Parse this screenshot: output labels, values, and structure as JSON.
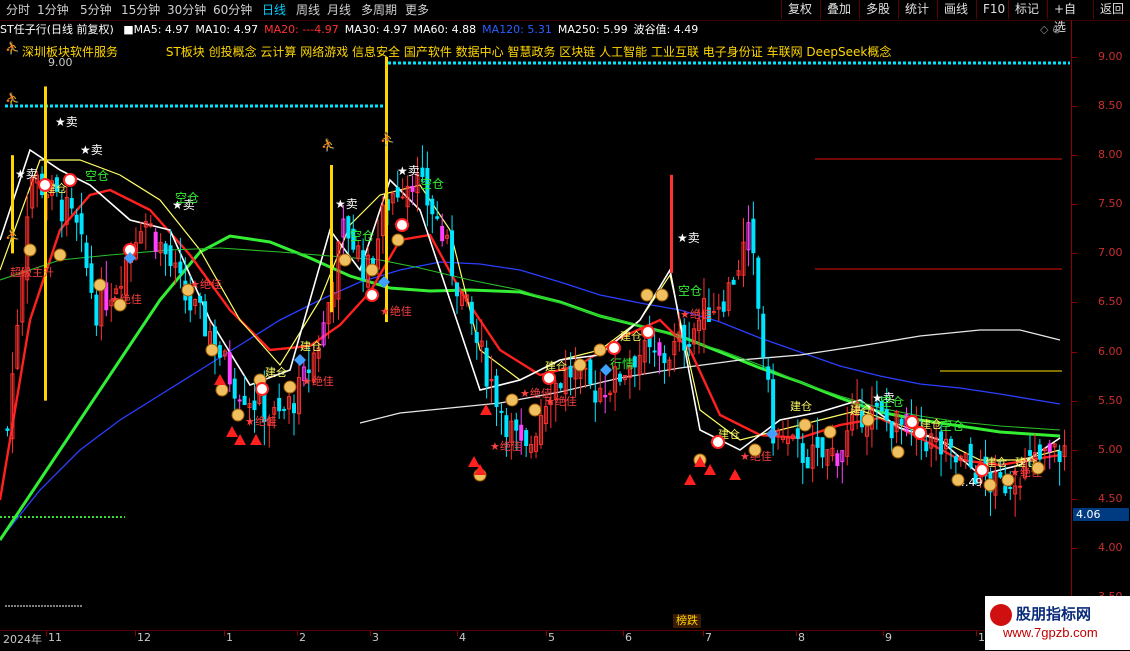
{
  "toolbar": {
    "periods": [
      "分时",
      "1分钟",
      "5分钟",
      "15分钟",
      "30分钟",
      "60分钟",
      "日线",
      "周线",
      "月线",
      "多周期",
      "更多"
    ],
    "active_period": "日线",
    "right_buttons": [
      "复权",
      "叠加",
      "多股",
      "统计",
      "画线",
      "F10",
      "标记",
      "+自选",
      "返回"
    ]
  },
  "header": {
    "title": "ST任子行(日线 前复权)",
    "ma": [
      {
        "label": "MA5: 4.97",
        "color": "#ffffff"
      },
      {
        "label": "MA10: 4.97",
        "color": "#ffffff"
      },
      {
        "label": "MA20: ---4.97",
        "color": "#ff3030"
      },
      {
        "label": "MA30: 4.97",
        "color": "#ffffff"
      },
      {
        "label": "MA60: 4.88",
        "color": "#ffffff"
      },
      {
        "label": "MA120: 5.31",
        "color": "#2a5fff"
      },
      {
        "label": "MA250: 5.99",
        "color": "#ffffff"
      },
      {
        "label": "波谷值: 4.49",
        "color": "#ffffff"
      }
    ],
    "concepts_left": "深圳板块软件服务",
    "concepts_right": "ST板块 创投概念 云计算 网络游戏 信息安全 国产软件 数据中心 智慧政务 区块链 人工智能 工业互联 电子身份证 车联网 DeepSeek概念"
  },
  "yaxis": {
    "ticks": [
      "9.00",
      "8.50",
      "8.00",
      "7.50",
      "7.00",
      "6.50",
      "6.00",
      "5.50",
      "5.00",
      "4.50",
      "4.00",
      "3.50"
    ],
    "current_price": "4.06"
  },
  "xaxis": {
    "ticks": [
      "2024年",
      "11",
      "12",
      "1",
      "2",
      "3",
      "4",
      "5",
      "6",
      "7",
      "8",
      "9",
      "10"
    ],
    "marker": "榜跌"
  },
  "annotations": {
    "sell": "卖",
    "build": "建仓",
    "empty": "空仓",
    "best": "绝佳",
    "super": "超级主升",
    "top_label": "9.00",
    "low_label": "4.49",
    "hang": "行情"
  },
  "chart_data": {
    "type": "candlestick",
    "title": "ST任子行(日线 前复权)",
    "ylim": [
      3.3,
      9.3
    ],
    "ma_lines": [
      {
        "name": "MA5",
        "color": "#ffffff"
      },
      {
        "name": "MA10",
        "color": "#ffff66"
      },
      {
        "name": "MA20",
        "color": "#ff3030"
      },
      {
        "name": "MA30",
        "color": "#33dd33"
      },
      {
        "name": "MA60",
        "color": "#33dd33"
      },
      {
        "name": "MA120",
        "color": "#2a5fff"
      },
      {
        "name": "MA250",
        "color": "#ffffff"
      }
    ],
    "close_path": [
      5.2,
      7.8,
      7.6,
      7.3,
      6.4,
      6.8,
      7.4,
      7.0,
      6.5,
      6.2,
      5.7,
      5.5,
      5.3,
      5.6,
      6.2,
      7.3,
      6.8,
      7.6,
      7.8,
      7.4,
      6.7,
      6.0,
      5.4,
      4.9,
      5.6,
      5.8,
      5.6,
      5.7,
      6.0,
      5.9,
      6.1,
      6.4,
      6.6,
      7.2,
      5.2,
      5.0,
      4.9,
      5.0,
      5.4,
      5.3,
      5.2,
      5.1,
      4.9,
      4.8,
      4.6,
      4.8,
      4.9,
      5.0
    ]
  },
  "watermark": {
    "title": "股朋指标网",
    "url": "www.7gpzb.com"
  },
  "colors": {
    "up": "#ff3030",
    "down": "#00e5ff",
    "hline_cyan": "#00e5ff",
    "hline_red": "#e01010",
    "hline_yellow": "#ffe000"
  }
}
